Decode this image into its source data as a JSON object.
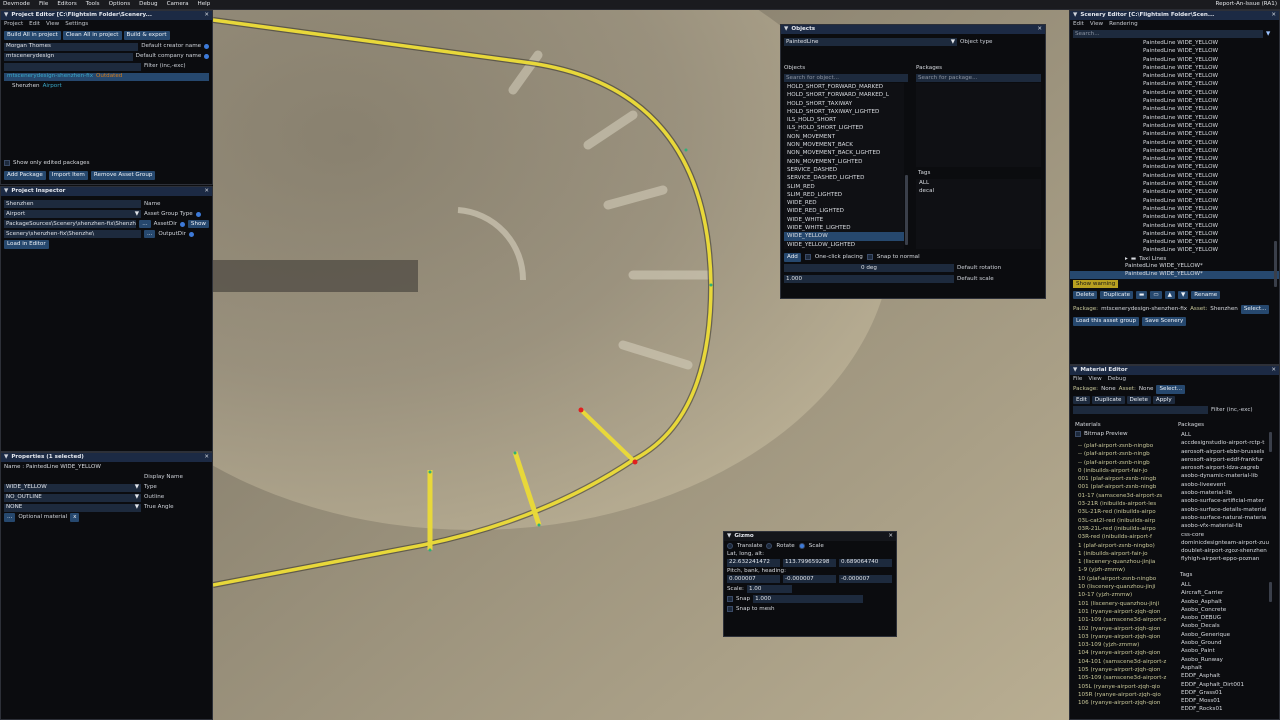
{
  "topbar": {
    "items": [
      "Devmode",
      "File",
      "Editors",
      "Tools",
      "Options",
      "Debug",
      "Camera",
      "Help"
    ],
    "right": "Report-An-Issue (RA1)"
  },
  "project_editor": {
    "title": "Project Editor [C:\\Flightsim Folder\\Scenery...",
    "menu": [
      "Project",
      "Edit",
      "View",
      "Settings"
    ],
    "buttons": [
      "Build All in project",
      "Clean All in project",
      "Build & export"
    ],
    "creator_value": "Morgan Thomes",
    "creator_label": "Default creator name",
    "company_value": "mtscenerydesign",
    "company_label": "Default company name",
    "filter_label": "Filter (inc,-exc)",
    "package_name": "mtscenerydesign-shenzhen-fix",
    "package_status": "Outdated",
    "group_name": "Shenzhen",
    "group_type": "Airport",
    "show_only_edited": "Show only edited packages",
    "actions": [
      "Add Package",
      "Import Item",
      "Remove Asset Group"
    ]
  },
  "project_inspector": {
    "title": "Project Inspector",
    "name_value": "Shenzhen",
    "name_label": "Name",
    "type_value": "Airport",
    "type_label": "Asset Group Type",
    "assetdir_value": "PackageSources\\Scenery\\shenzhen-fix\\Shenzhe\\",
    "assetdir_label": "AssetDir",
    "show_label": "Show",
    "outputdir_value": "Scenery\\shenzhen-fix\\Shenzhe\\",
    "outputdir_label": "OutputDir",
    "load_button": "Load in Editor",
    "ellipsis": "..."
  },
  "properties": {
    "title": "Properties (1 selected)",
    "name_line": "Name : PaintedLine WIDE_YELLOW",
    "display_name_label": "Display Name",
    "type_value": "WIDE_YELLOW",
    "type_label": "Type",
    "outline_value": "NO_OUTLINE",
    "outline_label": "Outline",
    "angle_value": "NONE",
    "angle_label": "True Angle",
    "optional_label": "Optional material",
    "optional_x": "x"
  },
  "objects": {
    "title": "Objects",
    "type_value": "PaintedLine",
    "type_label": "Object type",
    "objects_label": "Objects",
    "packages_label": "Packages",
    "search_obj": "Search for object...",
    "search_pkg": "Search for package...",
    "items": [
      "HOLD_SHORT_FORWARD_MARKED",
      "HOLD_SHORT_FORWARD_MARKED_L",
      "HOLD_SHORT_TAXIWAY",
      "HOLD_SHORT_TAXIWAY_LIGHTED",
      "ILS_HOLD_SHORT",
      "ILS_HOLD_SHORT_LIGHTED",
      "NON_MOVEMENT",
      "NON_MOVEMENT_BACK",
      "NON_MOVEMENT_BACK_LIGHTED",
      "NON_MOVEMENT_LIGHTED",
      "SERVICE_DASHED",
      "SERVICE_DASHED_LIGHTED",
      "SLIM_RED",
      "SLIM_RED_LIGHTED",
      "WIDE_RED",
      "WIDE_RED_LIGHTED",
      "WIDE_WHITE",
      "WIDE_WHITE_LIGHTED",
      "WIDE_YELLOW",
      "WIDE_YELLOW_LIGHTED"
    ],
    "selected_index": 18,
    "tags_label": "Tags",
    "tags": [
      "ALL",
      "decal"
    ],
    "add_button": "Add",
    "one_click": "One-click placing",
    "snap_normal": "Snap to normal",
    "rotation_value": "0 deg",
    "rotation_label": "Default rotation",
    "scale_value": "1.000",
    "scale_label": "Default scale"
  },
  "gizmo": {
    "title": "Gizmo",
    "modes": [
      "Translate",
      "Rotate",
      "Scale"
    ],
    "active_mode": "Scale",
    "latlon_label": "Lat, long, alt:",
    "lat": "22.632241472",
    "lon": "113.799659298",
    "alt": "0.689064740",
    "pbh_label": "Pitch, bank, heading:",
    "pitch": "0.000007",
    "bank": "-0.000007",
    "heading": "-0.000007",
    "scale_label": "Scale:",
    "scale_value": "1.00",
    "snap_label": "Snap",
    "snap_value": "1.000",
    "snap_mesh": "Snap to mesh"
  },
  "scenery_editor": {
    "title": "Scenery Editor [C:\\Flightsim Folder\\Scen...",
    "menu": [
      "Edit",
      "View",
      "Rendering"
    ],
    "search": "Search...",
    "item_label": "PaintedLine WIDE_YELLOW",
    "item_count": 26,
    "taxi_lines": "Taxi Lines",
    "selected_items": [
      "PaintedLine WIDE_YELLOW*",
      "PaintedLine WIDE_YELLOW*"
    ],
    "show_warning": "Show warning",
    "actions": [
      "Delete",
      "Duplicate",
      "Rename"
    ],
    "package_label": "Package:",
    "package_value": "mtscenerydesign-shenzhen-fix",
    "asset_label": "Asset:",
    "asset_value": "Shenzhen",
    "select_label": "Select...",
    "load_group": "Load this asset group",
    "save_scenery": "Save Scenery"
  },
  "material_editor": {
    "title": "Material Editor",
    "menu": [
      "File",
      "View",
      "Debug"
    ],
    "package_label": "Package:",
    "package_value": "None",
    "asset_label": "Asset:",
    "asset_value": "None",
    "select_label": "Select...",
    "actions": [
      "Edit",
      "Duplicate",
      "Delete",
      "Apply"
    ],
    "filter_label": "Filter (inc,-exc)",
    "materials_label": "Materials",
    "packages_label": "Packages",
    "bitmap_preview": "Bitmap Preview",
    "materials": [
      "-- (plaf-airport-zsnb-ningbo",
      "-- (plaf-airport-zsnb-ningb",
      "-- (plaf-airport-zsnb-ningb",
      "0 (inibuilds-airport-fair-jo",
      "001 (plaf-airport-zsnb-ningb",
      "001 (plaf-airport-zsnb-ningb",
      "01-17 (samscene3d-airport-zs",
      "03-21R (inibuilds-airport-les",
      "03L-21R-red (inibuilds-airpo",
      "03L-cat2I-red (inibuilds-airp",
      "03R-21L-red (inibuilds-airpo",
      "03R-red (inibuilds-airport-f",
      "1 (plaf-airport-zsnb-ningbo)",
      "1 (inibuilds-airport-fair-jo",
      "1 (liscenery-quanzhou-jinjia",
      "1-9 (yjzh-zmmw)",
      "10 (plaf-airport-zsnb-ningbo",
      "10 (liscenery-quanzhou-jinji",
      "10-17 (yjzh-zmmw)",
      "101 (liscenery-quanzhou-jinji",
      "101 (ryanye-airport-zjqh-qion",
      "101-109 (samscene3d-airport-z",
      "102 (ryanye-airport-zjqh-qion",
      "103 (ryanye-airport-zjqh-qion",
      "103-109 (yjzh-zmmw)",
      "104 (ryanye-airport-zjqh-qion",
      "104-101 (samscene3d-airport-z",
      "105 (ryanye-airport-zjqh-qion",
      "105-109 (samscene3d-airport-z",
      "105L (ryanye-airport-zjqh-qio",
      "105R (ryanye-airport-zjqh-qio",
      "106 (ryanye-airport-zjqh-qion"
    ],
    "packages": [
      "ALL",
      "accdesignstudio-airport-rctp-t",
      "aerosoft-airport-ebbr-brussels",
      "aerosoft-airport-eddf-frankfur",
      "aerosoft-airport-ldza-zagreb",
      "asobo-dynamic-material-lib",
      "asobo-liveevent",
      "asobo-material-lib",
      "asobo-surface-artificial-mater",
      "asobo-surface-details-material",
      "asobo-surface-natural-materia",
      "asobo-vfx-material-lib",
      "css-core",
      "dominicdesignteam-airport-zuu",
      "doublet-airport-zgoz-shenzhen",
      "flyhigh-airport-eppo-poznan"
    ],
    "tags_label": "Tags",
    "tags": [
      "ALL",
      "Aircraft_Carrier",
      "Asobo_Asphalt",
      "Asobo_Concrete",
      "Asobo_DEBUG",
      "Asobo_Decals",
      "Asobo_Generique",
      "Asobo_Ground",
      "Asobo_Paint",
      "Asobo_Runway",
      "Asphalt",
      "EDDF_Asphalt",
      "EDDF_Asphalt_Dirt001",
      "EDDF_Grass01",
      "EDDF_Moss01",
      "EDDF_Rocks01"
    ]
  },
  "colors": {
    "panel_bg": "#0b0c0f",
    "title_bg": "#1c2a44",
    "button": "#26486e",
    "line_yellow": "#e8d83a",
    "warning": "#b8a020"
  }
}
